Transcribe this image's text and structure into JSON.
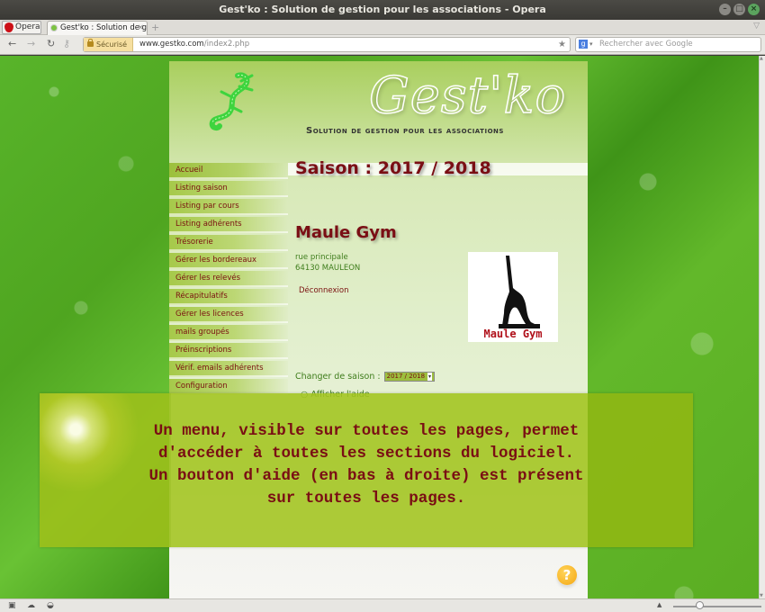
{
  "window": {
    "title": "Gest'ko : Solution de gestion pour les associations - Opera"
  },
  "browser": {
    "opera_label": "Opera",
    "tab_title": "Gest'ko : Solution de g...",
    "tab_close": "×",
    "new_tab": "+",
    "secure_label": "Sécurisé",
    "url_domain": "www.gestko.com",
    "url_path": "/index2.php",
    "search_placeholder": "Rechercher avec Google",
    "zoom_level": 0.3
  },
  "site": {
    "brand": "Gest'ko",
    "tagline": "Solution de gestion pour les associations",
    "season_heading": "Saison : 2017 / 2018"
  },
  "menu": {
    "items": [
      {
        "label": "Accueil"
      },
      {
        "label": "Listing saison"
      },
      {
        "label": "Listing par cours"
      },
      {
        "label": "Listing adhérents"
      },
      {
        "label": "Trésorerie"
      },
      {
        "label": "Gérer les bordereaux"
      },
      {
        "label": "Gérer les relevés"
      },
      {
        "label": "Récapitulatifs"
      },
      {
        "label": "Gérer les licences"
      },
      {
        "label": "mails groupés"
      },
      {
        "label": "Préinscriptions"
      },
      {
        "label": "Vérif. emails adhérents"
      },
      {
        "label": "Configuration"
      }
    ]
  },
  "association": {
    "name": "Maule Gym",
    "street": "rue principale",
    "city": "64130 MAULEON",
    "logout": "Déconnexion",
    "logo_text": "Maule Gym"
  },
  "season_control": {
    "label": "Changer de saison :",
    "selected": "2017 / 2018"
  },
  "help": {
    "show_help": "Afficher l'aide",
    "button": "?"
  },
  "overlay": {
    "lines": [
      "Un menu, visible sur toutes les pages, permet",
      "d'accéder à toutes les sections du logiciel.",
      "Un bouton d'aide (en bas à droite) est présent",
      "sur toutes les pages."
    ]
  },
  "colors": {
    "accent_dark_red": "#7a0e14",
    "address_green": "#3f7d1c",
    "overlay_green": "#a2c41e",
    "help_orange": "#f5a712"
  }
}
